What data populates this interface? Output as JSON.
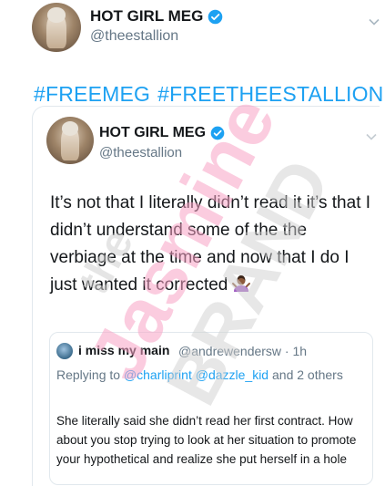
{
  "outer_tweet": {
    "author_name": "HOT GIRL MEG",
    "author_handle": "@theestallion",
    "hashtags": [
      "#FREEMEG",
      "#FREETHEESTALLION"
    ]
  },
  "quoted_tweet": {
    "author_name": "HOT GIRL MEG",
    "author_handle": "@theestallion",
    "text": "It’s not that I literally didn’t read it it’s that I didn’t understand some of the the verbiage at the time and now that I do I just wanted it corrected"
  },
  "reply_tweet": {
    "author_name": "i miss my main",
    "author_handle_time": "@andrewendersw · 1h",
    "replying_prefix": "Replying to",
    "mentions": [
      "@charliprint",
      "@dazzle_kid"
    ],
    "replying_suffix": "and 2 others",
    "text": "She literally said she didn’t read her first contract. How about you stop trying to look at her situation to promote your hypothetical and realize she put herself in a hole"
  },
  "watermark": {
    "line1": "the",
    "line2": "Jasmine",
    "line3": "BRAND"
  },
  "colors": {
    "link": "#1da1f2",
    "secondary_text": "#657786",
    "verified": "#1da1f2",
    "watermark_pink": "#f7a3c4",
    "watermark_gray": "#cfcfcf"
  },
  "icons": [
    "verified-badge-icon",
    "chevron-down-icon",
    "woman-shrugging-emoji"
  ]
}
